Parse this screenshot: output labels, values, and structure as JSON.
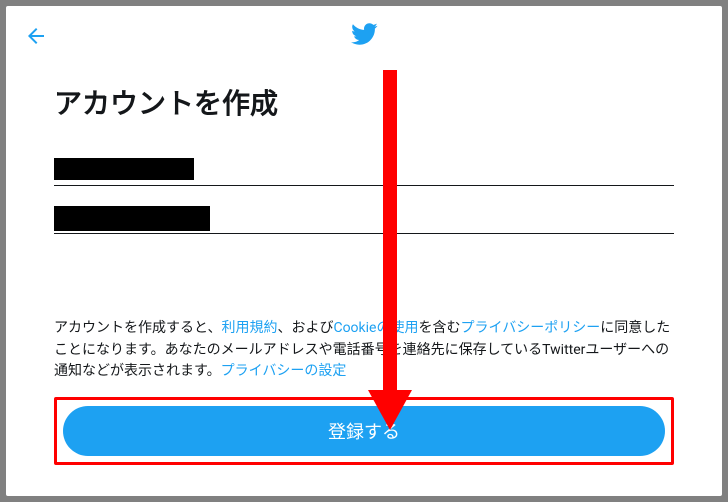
{
  "header": {
    "back_aria": "戻る",
    "logo_aria": "Twitter"
  },
  "title": "アカウントを作成",
  "fields": {
    "name_value": "",
    "contact_value": ""
  },
  "terms": {
    "prefix": "アカウントを作成すると、",
    "tos": "利用規約",
    "sep1": "、および",
    "cookie": "Cookieの使用",
    "sep2": "を含む",
    "privacy": "プライバシーポリシー",
    "mid": "に同意したことになります。あなたのメールアドレスや電話番号を連絡先に保存しているTwitterユーザーへの通知などが表示されます。",
    "privacy_settings": "プライバシーの設定"
  },
  "button": {
    "register": "登録する"
  },
  "colors": {
    "accent": "#1da1f2",
    "highlight": "#ff0000"
  }
}
